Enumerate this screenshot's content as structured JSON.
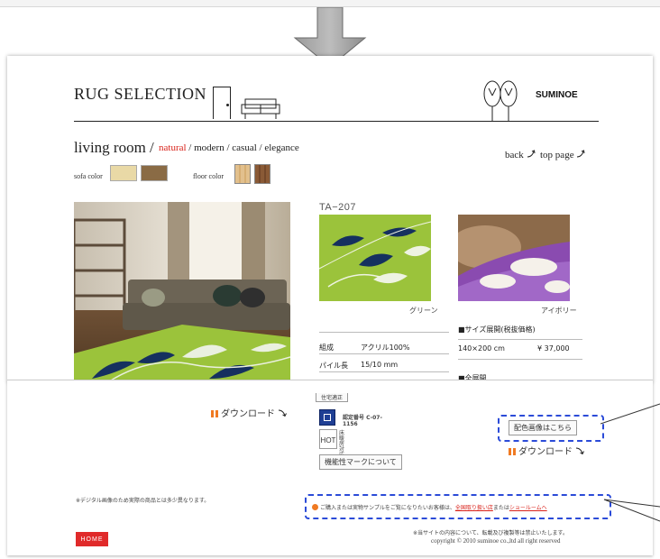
{
  "header": {
    "brand_title": "RUG SELECTION",
    "maker": "SUMINOE"
  },
  "room": {
    "title": "living room /",
    "styles": [
      "natural",
      "modern",
      "casual",
      "elegance"
    ],
    "active_style": "natural",
    "separator": " / "
  },
  "nav": {
    "back": "back",
    "top_page": "top page"
  },
  "colors": {
    "sofa_label": "sofa color",
    "floor_label": "floor color",
    "accent_red": "#d9231b",
    "rug_green": "#9bc33b",
    "rug_navy": "#15305f",
    "highlight_blue": "#2b4bd8"
  },
  "product": {
    "code": "TA−207",
    "variants": [
      {
        "caption": "グリーン"
      },
      {
        "caption": "アイボリー"
      }
    ]
  },
  "specs": {
    "size_heading": "■サイズ展開(税抜価格)",
    "size": "140×200 cm",
    "price": "¥ 37,000",
    "rows": [
      {
        "label": "組成",
        "value": "アクリル100%"
      },
      {
        "label": "パイル長",
        "value": "15/10 mm"
      }
    ],
    "partial_heading": "■全展開"
  },
  "bottom": {
    "download_label": "ダウンロード",
    "partial_tab": "住宅適正",
    "cert_number": "認定番号 C-07-1156",
    "hot_label": "HOT",
    "hot_side": "床暖房対応",
    "function_button": "機能性マークについて",
    "color_image_button": "配色画像はこちら",
    "digital_note": "※デジタル画像のため実際の商品とは多少異なります。",
    "sample_note_prefix": "ご購入または実物サンプルをご覧になりたいお客様は、",
    "sample_note_link1": "全国取り扱い店",
    "sample_note_mid": "または",
    "sample_note_link2": "ショールームへ",
    "copyright_note": "※当サイトの内容について、転載及び複製等は禁止いたします。",
    "copyright": "copyright © 2010 suminoe co.,ltd all right reserved",
    "home": "HOME"
  }
}
